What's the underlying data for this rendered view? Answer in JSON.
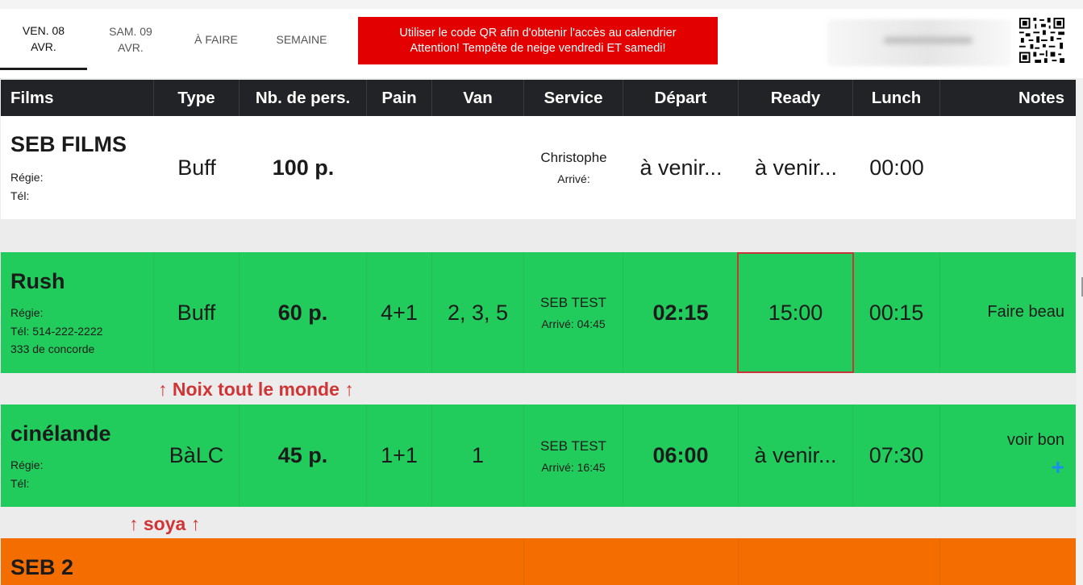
{
  "tabs": [
    {
      "label": "VEN. 08\nAVR.",
      "active": true
    },
    {
      "label": "SAM. 09\nAVR.",
      "active": false
    },
    {
      "label": "À FAIRE",
      "active": false
    },
    {
      "label": "SEMAINE",
      "active": false
    }
  ],
  "alert": {
    "line1": "Utiliser le code QR afin d'obtenir l'accès au calendrier",
    "line2": "Attention! Tempête de neige vendredi ET samedi!",
    "color": "#e30000"
  },
  "header": {
    "films": "Films",
    "type": "Type",
    "nb": "Nb. de pers.",
    "pain": "Pain",
    "van": "Van",
    "service": "Service",
    "depart": "Départ",
    "ready": "Ready",
    "lunch": "Lunch",
    "notes": "Notes"
  },
  "rows": [
    {
      "name": "SEB FILMS",
      "regie": "Régie:",
      "tel": "Tél:",
      "address": "",
      "type": "Buff",
      "nb": "100 p.",
      "pain": "",
      "van": "",
      "service_name": "Christophe",
      "arrive": "Arrivé:",
      "depart": "à venir...",
      "ready": "à venir...",
      "lunch": "00:00",
      "notes": "",
      "color": "#ffffff"
    },
    {
      "name": "Rush",
      "regie": "Régie:",
      "tel": "Tél: 514-222-2222",
      "address": "333 de concorde",
      "type": "Buff",
      "nb": "60 p.",
      "pain": "4+1",
      "van": "2, 3, 5",
      "service_name": "SEB TEST",
      "arrive": "Arrivé: 04:45",
      "depart": "02:15",
      "ready": "15:00",
      "lunch": "00:15",
      "notes": "Faire beau",
      "color": "#22cc5c"
    },
    {
      "name": "cinélande",
      "regie": "Régie:",
      "tel": "Tél:",
      "address": "",
      "type": "BàLC",
      "nb": "45 p.",
      "pain": "1+1",
      "van": "1",
      "service_name": "SEB TEST",
      "arrive": "Arrivé: 16:45",
      "depart": "06:00",
      "ready": "à venir...",
      "lunch": "07:30",
      "notes": "voir bon",
      "color": "#22cc5c"
    },
    {
      "name": "SEB 2",
      "color": "#f46d00"
    }
  ],
  "separators": [
    "↑ Noix tout le monde ↑",
    "↑ soya ↑"
  ],
  "icons": {
    "plus": "+",
    "qr": "qr-code-icon"
  }
}
